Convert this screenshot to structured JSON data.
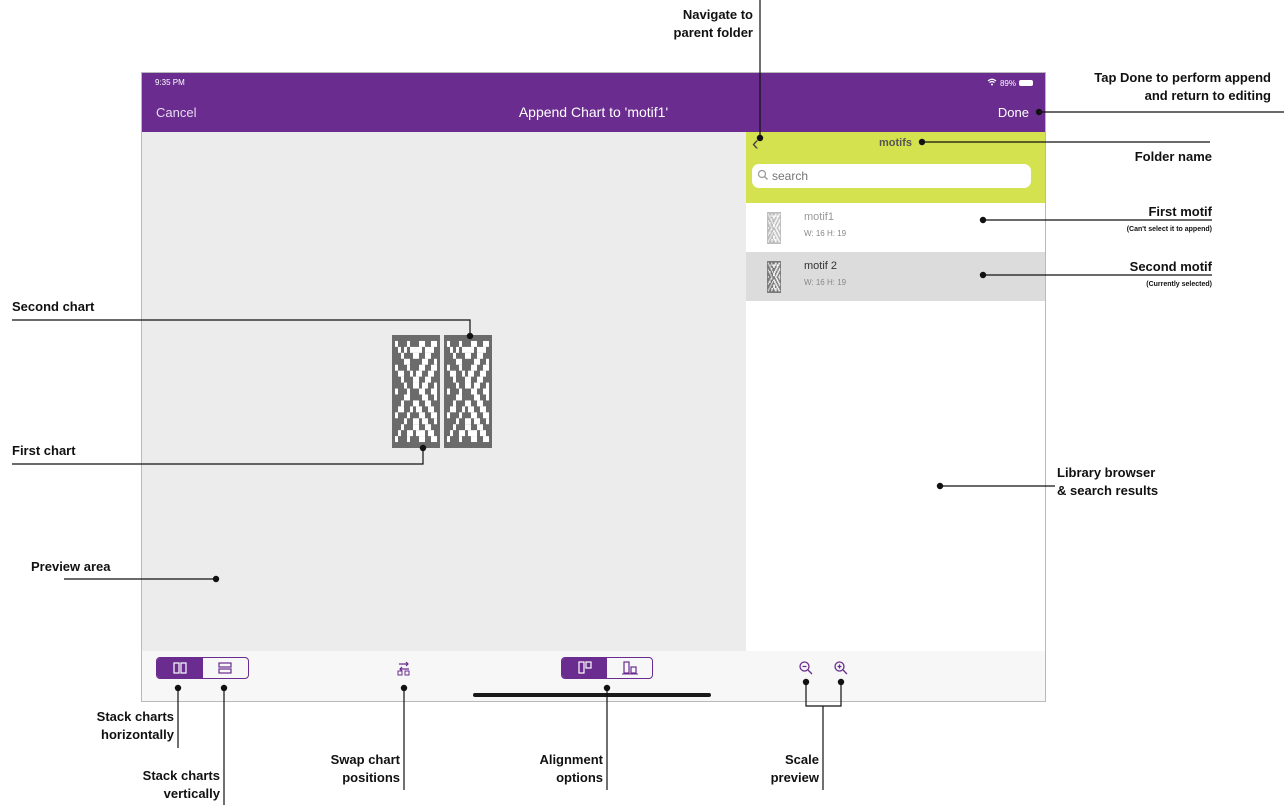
{
  "status_bar": {
    "time": "9:35 PM",
    "battery": "89%"
  },
  "navbar": {
    "cancel_label": "Cancel",
    "title": "Append Chart to 'motif1'",
    "done_label": "Done"
  },
  "library": {
    "folder_name": "motifs",
    "search_placeholder": "search",
    "motifs": [
      {
        "name": "motif1",
        "size": "W: 16 H: 19",
        "selected": false
      },
      {
        "name": "motif 2",
        "size": "W: 16 H: 19",
        "selected": true
      }
    ]
  },
  "toolbar": {
    "icons": [
      "stack-horizontal-icon",
      "stack-vertical-icon",
      "swap-icon",
      "align-top-icon",
      "align-bottom-icon",
      "zoom-out-icon",
      "zoom-in-icon"
    ]
  },
  "colors": {
    "brand_purple": "#6a2c8f",
    "folder_bar": "#d5e24f",
    "preview_bg": "#ececec",
    "chart_dark": "#6b6b6b"
  },
  "annotations": {
    "navigate_parent": "Navigate to\nparent folder",
    "tap_done": "Tap Done to perform append\nand return to editing",
    "folder_name": "Folder name",
    "first_motif": "First motif",
    "first_motif_note": "(Can't select it to append)",
    "second_motif": "Second motif",
    "second_motif_note": "(Currently selected)",
    "second_chart": "Second chart",
    "first_chart": "First chart",
    "library_browser": "Library browser\n& search results",
    "preview_area": "Preview area",
    "stack_horizontal": "Stack charts\nhorizontally",
    "stack_vertical": "Stack charts\nvertically",
    "swap_positions": "Swap chart\npositions",
    "alignment_options": "Alignment\noptions",
    "scale_preview": "Scale\npreview"
  }
}
